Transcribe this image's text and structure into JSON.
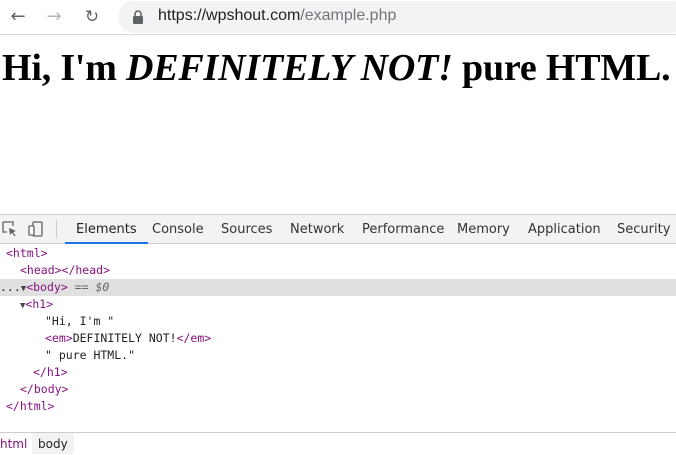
{
  "browser": {
    "back_icon": "←",
    "forward_icon": "→",
    "reload_icon": "↻",
    "url_main": "https://wpshout.com",
    "url_path": "/example.php"
  },
  "page": {
    "h1_before": "Hi, I'm ",
    "h1_em": "DEFINITELY NOT!",
    "h1_after": " pure HTML."
  },
  "devtools": {
    "tabs": [
      "Elements",
      "Console",
      "Sources",
      "Network",
      "Performance",
      "Memory",
      "Application",
      "Security"
    ],
    "tree": {
      "html_open": "<html>",
      "head": "<head></head>",
      "dots": "...",
      "body_open": "<body>",
      "body_meta": "== $0",
      "h1_open": "<h1>",
      "text1": "\"Hi, I'm \"",
      "em_open": "<em>",
      "em_text": "DEFINITELY NOT!",
      "em_close": "</em>",
      "text2": "\" pure HTML.\"",
      "h1_close": "</h1>",
      "body_close": "</body>",
      "html_close": "</html>"
    },
    "breadcrumbs": [
      "html",
      "body"
    ]
  }
}
